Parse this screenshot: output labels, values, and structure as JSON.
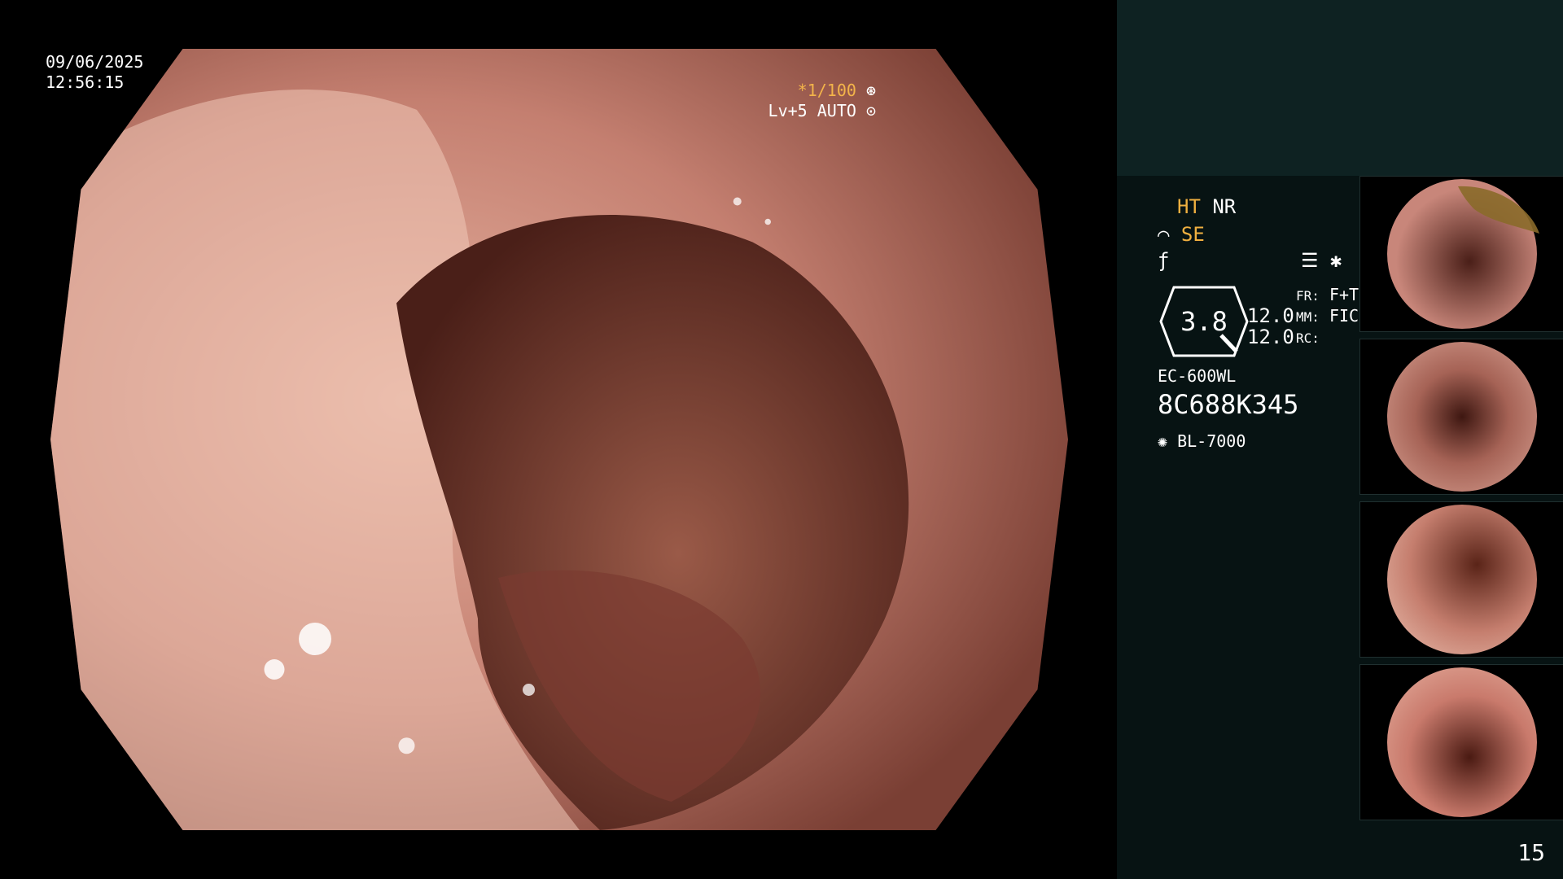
{
  "main": {
    "date": "09/06/2025",
    "time": "12:56:15",
    "shutter": "*1/100",
    "level": "Lv+5 AUTO"
  },
  "panel": {
    "ht": "HT",
    "nr": "NR",
    "se": "SE",
    "magnification": "3.8",
    "val1": "12.0",
    "val2": "12.0",
    "fr_label": "FR:",
    "fr_value": "F+T",
    "mm_label": "MM:",
    "mm_value": "FICE",
    "rc_label": "RC:",
    "scope_model": "EC-600WL",
    "serial": "8C688K345",
    "light_source": "BL-7000",
    "page": "15"
  },
  "colors": {
    "amber": "#f0b040",
    "panel_bg": "#071313",
    "panel_top": "#0e2222"
  },
  "icons": [
    "star-icon",
    "settings-icon",
    "light-source-icon",
    "iris-icon",
    "aperture-icon"
  ]
}
